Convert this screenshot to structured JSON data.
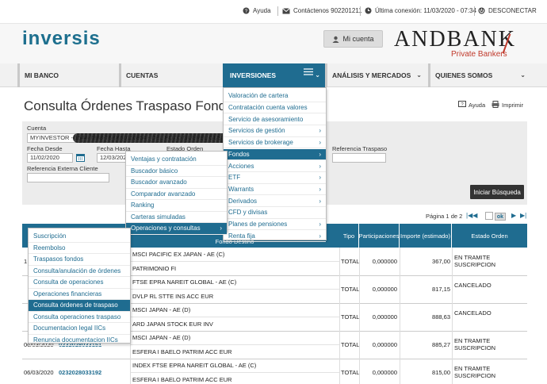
{
  "topbar": {
    "ayuda": "Ayuda",
    "contacto": "Contáctenos 902201211",
    "ultima": "Última conexión: 11/03/2020 - 07:34",
    "desconectar": "DESCONECTAR"
  },
  "brand": {
    "logo": "inversis",
    "mi_cuenta": "Mi cuenta",
    "partner": "ANDBANK",
    "partner_sub": "Private Bankers"
  },
  "nav": {
    "items": [
      "MI BANCO",
      "CUENTAS",
      "INVERSIONES",
      "ANÁLISIS Y MERCADOS",
      "QUIENES SOMOS"
    ]
  },
  "page": {
    "title": "Consulta Órdenes Traspaso Fondos",
    "ayuda": "Ayuda",
    "imprimir": "Imprimir"
  },
  "form": {
    "cuenta_label": "Cuenta",
    "cuenta_value": "MYINVESTOR - 1544-7888-76-0650110854 - DEL POZO GUEREL GUSTAVO",
    "fecha_desde_label": "Fecha Desde",
    "fecha_desde": "11/02/2020",
    "fecha_hasta_label": "Fecha Hasta",
    "fecha_hasta": "12/03/2020",
    "estado_label": "Estado Orden",
    "ref_traspaso_label": "Referencia Traspaso",
    "ref_externa_label": "Referencia Externa Cliente",
    "iniciar": "Iniciar Búsqueda"
  },
  "pagination": {
    "text": "Página 1 de 2",
    "ok": "ok"
  },
  "table": {
    "headers": {
      "fondo_destino": "Fondo Destino",
      "tipo": "Tipo",
      "participaciones": "Participaciones",
      "importe": "Importe (estimado)",
      "estado": "Estado Orden"
    },
    "rows": [
      {
        "fecha": "1",
        "ref": "",
        "origen": "MSCI PACIFIC EX JAPAN - AE (C)",
        "destino": "PATRIMONIO FI",
        "tipo": "TOTAL",
        "part": "0,000000",
        "importe": "367,00",
        "estado": "EN TRAMITE SUSCRIPCION"
      },
      {
        "fecha": "",
        "ref": "",
        "origen": "FTSE EPRA NAREIT GLOBAL - AE (C)",
        "destino": "DVLP RL STTE INS ACC EUR",
        "tipo": "TOTAL",
        "part": "0,000000",
        "importe": "817,15",
        "estado": "CANCELADO"
      },
      {
        "fecha": "",
        "ref": "",
        "origen": "MSCI JAPAN - AE (D)",
        "destino": "ARD JAPAN STOCK EUR INV",
        "tipo": "TOTAL",
        "part": "0,000000",
        "importe": "888,63",
        "estado": "CANCELADO"
      },
      {
        "fecha": "06/03/2020",
        "ref": "0232028033151",
        "origen": "MSCI JAPAN - AE (D)",
        "destino": "ESFERA I BAELO PATRIM ACC EUR",
        "tipo": "TOTAL",
        "part": "0,000000",
        "importe": "885,27",
        "estado": "EN TRAMITE SUSCRIPCION"
      },
      {
        "fecha": "06/03/2020",
        "ref": "0232028033192",
        "origen": "INDEX FTSE EPRA NAREIT GLOBAL - AE (C)",
        "destino": "ESFERA I BAELO PATRIM ACC EUR",
        "tipo": "TOTAL",
        "part": "0,000000",
        "importe": "815,00",
        "estado": "EN TRAMITE SUSCRIPCION"
      }
    ]
  },
  "menu_inversiones": [
    "Valoración de cartera",
    "Contratación cuenta valores",
    "Servicio de asesoramiento",
    "Servicios de gestión",
    "Servicios de brokerage",
    "Fondos",
    "Acciones",
    "ETF",
    "Warrants",
    "Derivados",
    "CFD y divisas",
    "Planes de pensiones",
    "Renta fija"
  ],
  "menu_fondos": [
    "Ventajas y contratación",
    "Buscador básico",
    "Buscador avanzado",
    "Comparador avanzado",
    "Ranking",
    "Carteras simuladas",
    "Operaciones y consultas"
  ],
  "menu_operaciones": [
    "Suscripción",
    "Reembolso",
    "Traspasos fondos",
    "Consulta/anulación de órdenes",
    "Consulta de operaciones",
    "Operaciones financieras",
    "Consulta órdenes de traspaso",
    "Consulta operaciones traspaso",
    "Documentacion legal IICs",
    "Renuncia documentacion IICs"
  ],
  "colors": {
    "primary": "#1f6c90",
    "partner_red": "#c0392b"
  }
}
